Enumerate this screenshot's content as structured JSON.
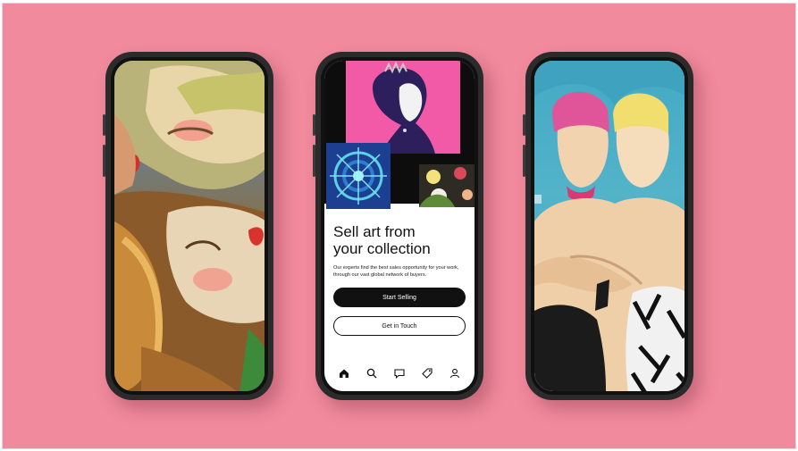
{
  "app": {
    "headline": "Sell art from\nyour collection",
    "subtext": "Our experts find the best sales opportunity for your work,\nthrough our vast global network of buyers.",
    "primary_button": "Start Selling",
    "secondary_button": "Get in Touch"
  },
  "tabbar": {
    "items": [
      {
        "icon": "home-icon",
        "active": true
      },
      {
        "icon": "search-icon",
        "active": false
      },
      {
        "icon": "inbox-icon",
        "active": false
      },
      {
        "icon": "tag-icon",
        "active": false
      },
      {
        "icon": "profile-icon",
        "active": false
      }
    ]
  },
  "colors": {
    "background": "#f08a9c",
    "primary_button": "#111111"
  }
}
